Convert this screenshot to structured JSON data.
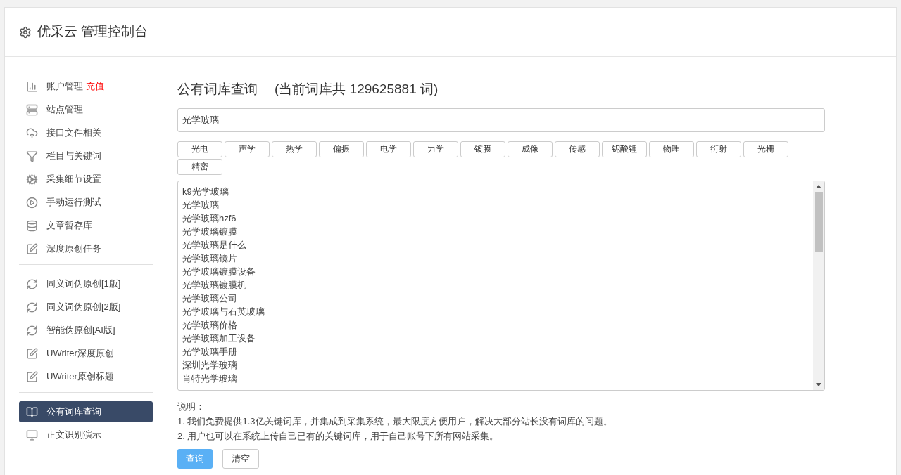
{
  "header": {
    "title": "优采云 管理控制台"
  },
  "sidebar": {
    "groups": [
      {
        "items": [
          {
            "label": "账户管理",
            "badge": "充值",
            "selected": false
          },
          {
            "label": "站点管理",
            "selected": false
          },
          {
            "label": "接口文件相关",
            "selected": false
          },
          {
            "label": "栏目与关键词",
            "selected": false
          },
          {
            "label": "采集细节设置",
            "selected": false
          },
          {
            "label": "手动运行测试",
            "selected": false
          },
          {
            "label": "文章暂存库",
            "selected": false
          },
          {
            "label": "深度原创任务",
            "selected": false
          }
        ]
      },
      {
        "items": [
          {
            "label": "同义词伪原创[1版]",
            "selected": false
          },
          {
            "label": "同义词伪原创[2版]",
            "selected": false
          },
          {
            "label": "智能伪原创[AI版]",
            "selected": false
          },
          {
            "label": "UWriter深度原创",
            "selected": false
          },
          {
            "label": "UWriter原创标题",
            "selected": false
          }
        ]
      },
      {
        "items": [
          {
            "label": "公有词库查询",
            "selected": true
          },
          {
            "label": "正文识别演示",
            "selected": false
          }
        ]
      }
    ]
  },
  "main": {
    "title": "公有词库查询",
    "subtitle": "(当前词库共 129625881 词)",
    "search": {
      "value": "光学玻璃"
    },
    "tags": [
      "光电",
      "声学",
      "热学",
      "偏振",
      "电学",
      "力学",
      "镀膜",
      "成像",
      "传感",
      "铌酸锂",
      "物理",
      "衍射",
      "光栅",
      "精密"
    ],
    "results": [
      "k9光学玻璃",
      "光学玻璃",
      "光学玻璃hzf6",
      "光学玻璃镀膜",
      "光学玻璃是什么",
      "光学玻璃镜片",
      "光学玻璃镀膜设备",
      "光学玻璃镀膜机",
      "光学玻璃公司",
      "光学玻璃与石英玻璃",
      "光学玻璃价格",
      "光学玻璃加工设备",
      "光学玻璃手册",
      "深圳光学玻璃",
      "肖特光学玻璃"
    ],
    "notes_title": "说明：",
    "notes": [
      "1. 我们免费提供1.3亿关键词库，并集成到采集系统，最大限度方便用户，解决大部分站长没有词库的问题。",
      "2. 用户也可以在系统上传自己已有的关键词库，用于自己账号下所有网站采集。"
    ],
    "buttons": [
      {
        "label": "查询",
        "kind": "primary"
      },
      {
        "label": "清空",
        "kind": "default"
      }
    ]
  }
}
